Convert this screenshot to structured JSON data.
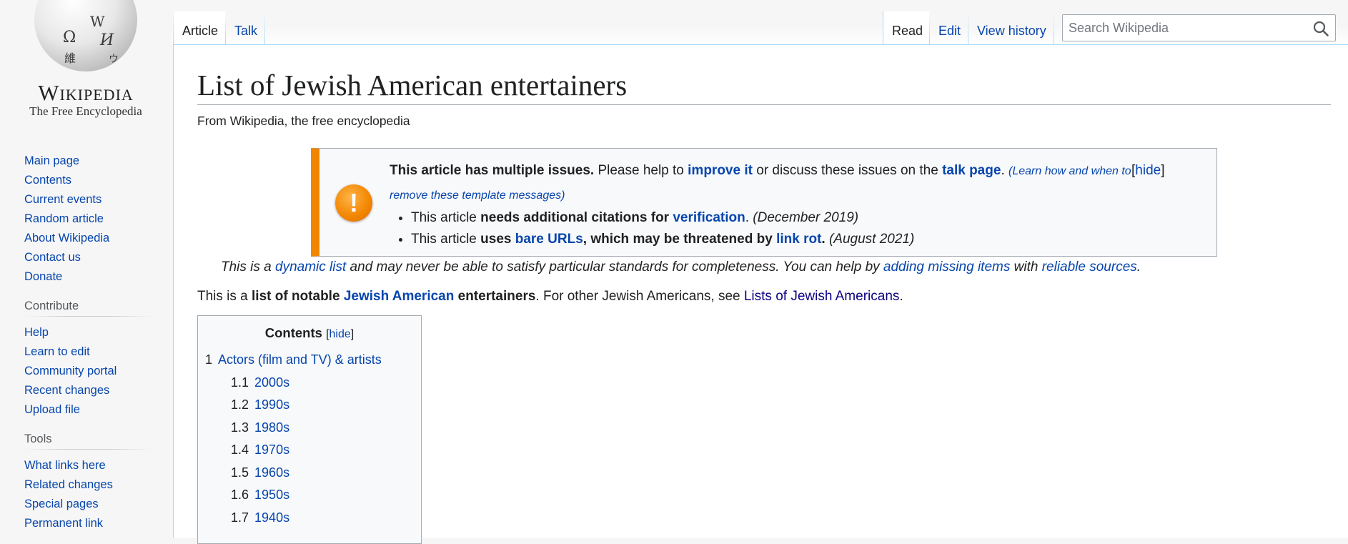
{
  "logo": {
    "wordmark": "Wikipedia",
    "tagline": "The Free Encyclopedia",
    "glyphs": [
      "Ω",
      "W",
      "И",
      "維",
      "ウ"
    ]
  },
  "sidebar": {
    "navigation": [
      {
        "label": "Main page"
      },
      {
        "label": "Contents"
      },
      {
        "label": "Current events"
      },
      {
        "label": "Random article"
      },
      {
        "label": "About Wikipedia"
      },
      {
        "label": "Contact us"
      },
      {
        "label": "Donate"
      }
    ],
    "contribute_heading": "Contribute",
    "contribute": [
      {
        "label": "Help"
      },
      {
        "label": "Learn to edit"
      },
      {
        "label": "Community portal"
      },
      {
        "label": "Recent changes"
      },
      {
        "label": "Upload file"
      }
    ],
    "tools_heading": "Tools",
    "tools": [
      {
        "label": "What links here"
      },
      {
        "label": "Related changes"
      },
      {
        "label": "Special pages"
      },
      {
        "label": "Permanent link"
      }
    ]
  },
  "tabs": {
    "left": [
      {
        "label": "Article",
        "selected": true
      },
      {
        "label": "Talk",
        "selected": false
      }
    ],
    "right": [
      {
        "label": "Read",
        "selected": true
      },
      {
        "label": "Edit",
        "selected": false
      },
      {
        "label": "View history",
        "selected": false
      }
    ]
  },
  "search": {
    "placeholder": "Search Wikipedia",
    "value": ""
  },
  "article": {
    "title": "List of Jewish American entertainers",
    "site_sub": "From Wikipedia, the free encyclopedia",
    "ambox": {
      "intro_bold": "This article has multiple issues.",
      "intro_1": " Please help to ",
      "improve_link": "improve it",
      "intro_2": " or discuss these issues on the ",
      "talk_link": "talk page",
      "intro_3": ". ",
      "learn_link": "(Learn how and when to remove these template messages)",
      "hide_label": "hide",
      "issues": [
        {
          "pre": "This article ",
          "bold": "needs additional citations for ",
          "link": "verification",
          "post": ". ",
          "date": "(December 2019)"
        },
        {
          "pre": "This article ",
          "bold": "uses ",
          "link": "bare URLs",
          "bold2": ", which may be threatened by ",
          "link2": "link rot",
          "post": ". ",
          "date": "(August 2021)"
        }
      ]
    },
    "hatnote": {
      "t1": "This is a ",
      "link1": "dynamic list",
      "t2": " and may never be able to satisfy particular standards for completeness. You can help by ",
      "link2": "adding missing items",
      "t3": " with ",
      "link3": "reliable sources",
      "t4": "."
    },
    "lead": {
      "t1": "This is a ",
      "bold1": "list of notable ",
      "link1": "Jewish American",
      "bold2": " entertainers",
      "t2": ". For other Jewish Americans, see ",
      "link2": "Lists of Jewish Americans",
      "t3": "."
    }
  },
  "toc": {
    "title": "Contents",
    "toggle": "hide",
    "items": [
      {
        "num": "1",
        "label": "Actors (film and TV) & artists",
        "level": 1
      },
      {
        "num": "1.1",
        "label": "2000s",
        "level": 2
      },
      {
        "num": "1.2",
        "label": "1990s",
        "level": 2
      },
      {
        "num": "1.3",
        "label": "1980s",
        "level": 2
      },
      {
        "num": "1.4",
        "label": "1970s",
        "level": 2
      },
      {
        "num": "1.5",
        "label": "1960s",
        "level": 2
      },
      {
        "num": "1.6",
        "label": "1950s",
        "level": 2
      },
      {
        "num": "1.7",
        "label": "1940s",
        "level": 2
      }
    ]
  },
  "colors": {
    "link": "#0645ad",
    "visited_link": "#0b0080",
    "ambox_accent": "#f28500",
    "border": "#a2a9b1",
    "tab_border": "#a7d7f9"
  }
}
